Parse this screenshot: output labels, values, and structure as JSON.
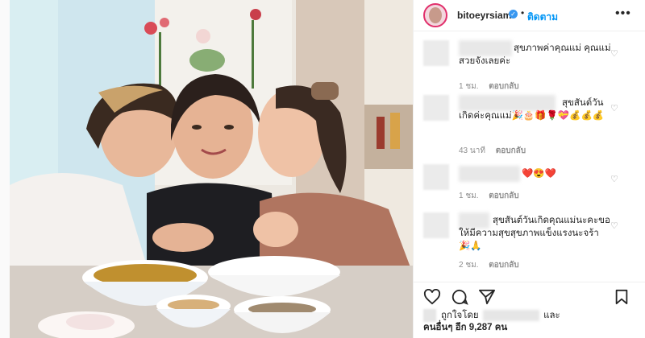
{
  "header": {
    "username": "bitoeyrsiam",
    "verified_glyph": "✓",
    "separator": "•",
    "follow_label": "ติดตาม",
    "more_label": "•••"
  },
  "comments": [
    {
      "text": "สุขภาพค่าคุณแม่ คุณแม่สวยจังเลยค่ะ",
      "time": "1 ชม.",
      "reply": "ตอบกลับ"
    },
    {
      "text": "สุขสันต์วันเกิดค่ะคุณแม่🎉🎂🎁🌹💝💰💰💰",
      "time": "43 นาที",
      "reply": "ตอบกลับ"
    },
    {
      "text": "❤️😍❤️",
      "time": "1 ชม.",
      "reply": "ตอบกลับ"
    },
    {
      "text": "สุขสันต์วันเกิดคุณแม่นะคะขอให้มีความสุขสุขภาพแข็งแรงนะจร้า 🎉🙏",
      "time": "2 ชม.",
      "reply": "ตอบกลับ"
    }
  ],
  "likes": {
    "liked_by": "ถูกใจโดย",
    "and": "และ",
    "others": "คนอื่นๆ อีก 9,287 คน"
  },
  "icons": {
    "heart": "heart-icon",
    "comment": "comment-icon",
    "share": "share-icon",
    "bookmark": "bookmark-icon"
  }
}
